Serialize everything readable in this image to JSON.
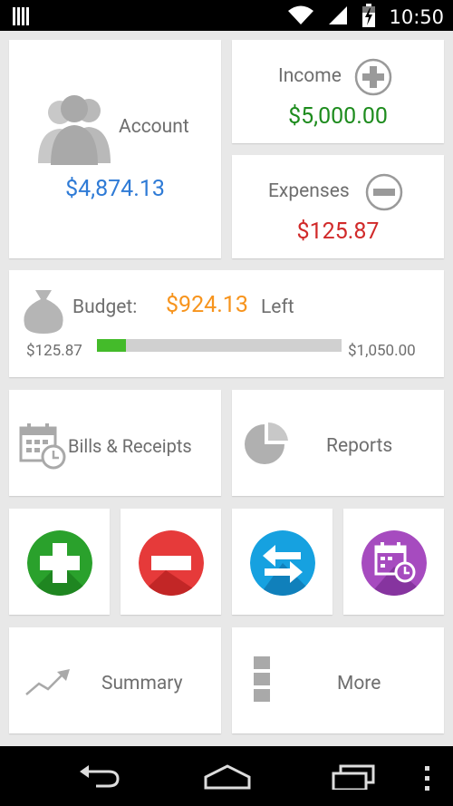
{
  "status_bar": {
    "time": "10:50",
    "icons": [
      "menu-grip-icon",
      "wifi-icon",
      "signal-icon",
      "battery-icon"
    ]
  },
  "account": {
    "label": "Account",
    "balance": "$4,874.13",
    "icon": "people-icon",
    "balance_color": "#2f7bd6"
  },
  "income": {
    "label": "Income",
    "value": "$5,000.00",
    "icon": "plus-circle-icon",
    "value_color": "#1e8c1e"
  },
  "expenses": {
    "label": "Expenses",
    "value": "$125.87",
    "icon": "minus-circle-icon",
    "value_color": "#d12a2a"
  },
  "budget": {
    "label": "Budget:",
    "remaining": "$924.13",
    "remaining_suffix": "Left",
    "spent": "$125.87",
    "total": "$1,050.00",
    "progress_fraction": 0.1199,
    "icon": "money-bag-icon",
    "remaining_color": "#f7941d",
    "progress_color": "#44bb2a"
  },
  "bills": {
    "label": "Bills & Receipts",
    "icon": "calendar-clock-icon"
  },
  "reports": {
    "label": "Reports",
    "icon": "pie-chart-icon"
  },
  "quick_actions": [
    {
      "name": "add-income-button",
      "icon": "plus-icon",
      "color": "#2aa12c"
    },
    {
      "name": "add-expense-button",
      "icon": "minus-icon",
      "color": "#e63a3a"
    },
    {
      "name": "transfer-button",
      "icon": "transfer-arrows-icon",
      "color": "#16a1e0"
    },
    {
      "name": "schedule-button",
      "icon": "calendar-clock-icon",
      "color": "#a64bbf"
    }
  ],
  "summary": {
    "label": "Summary",
    "icon": "trend-line-icon"
  },
  "more": {
    "label": "More",
    "icon": "stacked-blocks-icon"
  },
  "nav_bar": {
    "icons": [
      "back-icon",
      "home-icon",
      "recents-icon",
      "overflow-menu-icon"
    ]
  }
}
